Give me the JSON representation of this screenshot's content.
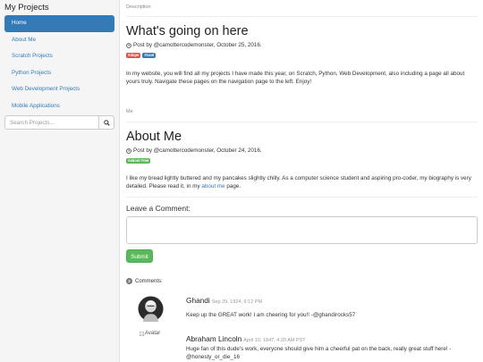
{
  "sidebar": {
    "title": "My Projects",
    "items": [
      {
        "label": "Home",
        "active": true
      },
      {
        "label": "About Me",
        "active": false
      },
      {
        "label": "Scratch Projects",
        "active": false
      },
      {
        "label": "Python Projects",
        "active": false
      },
      {
        "label": "Web Development Projects",
        "active": false
      },
      {
        "label": "Mobile Applications",
        "active": false
      }
    ],
    "search_placeholder": "Search Projects...",
    "search_icon": "search-icon"
  },
  "posts": [
    {
      "section": "Description",
      "title": "What's going on here",
      "meta": "Post by @camottercodemonster, October 25, 2016.",
      "tags": [
        {
          "label": "#dope",
          "color": "#d9534f"
        },
        {
          "label": "#cool",
          "color": "#337ab7"
        }
      ],
      "body": "In my website, you will find all my projects I have made this year, on Scratch, Python, Web Development, also including a page all about yours truly. Navigate these pages on the navigation page to the left. Enjoy!"
    },
    {
      "section": "Me",
      "title": "About Me",
      "meta": "Post by @camottercodemonster, October 24, 2016.",
      "tags": [
        {
          "label": "#about #me",
          "color": "#5cb85c"
        }
      ],
      "body_before": "I like my bread lightly buttered and my pancakes slightly chilly. As a computer science student and aspiring pro-coder, my biography is very detailed. Please read it, in my ",
      "body_link": "about me",
      "body_after": " page."
    }
  ],
  "comment_form": {
    "heading": "Leave a Comment:",
    "value": "",
    "submit_label": "Submit"
  },
  "comments_section": {
    "count": "2",
    "label": "Comments:",
    "comments": [
      {
        "author": "Ghandi",
        "date": "Sep 29, 1924, 9:12 PM",
        "text": "Keep up the GREAT work! I am cheering for you!! -@ghandirocks57",
        "avatar_alt": ""
      },
      {
        "author": "Abraham Lincoln",
        "date": "April 10, 1847, 4:20 AM PST",
        "text": "Huge fan of this dude's work, everyone should give him a cheerful pat on the back, really great stuff here! -@honesty_or_die_16",
        "avatar_alt": "Avatar"
      }
    ]
  },
  "colors": {
    "accent": "#337ab7",
    "success": "#5cb85c",
    "danger": "#d9534f"
  }
}
